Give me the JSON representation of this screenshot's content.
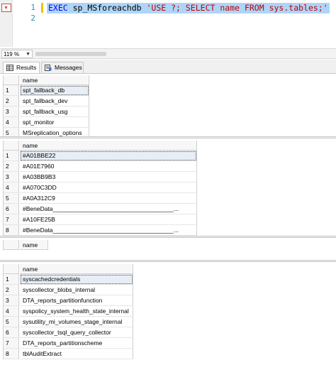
{
  "editor": {
    "line_numbers": [
      "1",
      "2"
    ],
    "code": {
      "kw1": "EXEC",
      "proc": " sp_MSforeachdb ",
      "str": "'USE ?; SELECT name FROM sys.tables;'"
    }
  },
  "zoom": {
    "value": "119 %"
  },
  "tabs": [
    {
      "label": "Results",
      "icon": "grid-icon",
      "active": true
    },
    {
      "label": "Messages",
      "icon": "messages-icon",
      "active": false
    }
  ],
  "grids": [
    {
      "column": "name",
      "rows": [
        {
          "n": "1",
          "v": "spt_fallback_db"
        },
        {
          "n": "2",
          "v": "spt_fallback_dev"
        },
        {
          "n": "3",
          "v": "spt_fallback_usg"
        },
        {
          "n": "4",
          "v": "spt_monitor"
        },
        {
          "n": "5",
          "v": "MSreplication_options"
        }
      ]
    },
    {
      "column": "name",
      "rows": [
        {
          "n": "1",
          "v": "#A01BBE22"
        },
        {
          "n": "2",
          "v": "#A01E7960"
        },
        {
          "n": "3",
          "v": "#A03BB9B3"
        },
        {
          "n": "4",
          "v": "#A070C3DD"
        },
        {
          "n": "5",
          "v": "#A0A312C9"
        },
        {
          "n": "6",
          "v": "#BeneData____________________________________..."
        },
        {
          "n": "7",
          "v": "#A10FE25B"
        },
        {
          "n": "8",
          "v": "#BeneData____________________________________..."
        }
      ]
    },
    {
      "column": "name",
      "rows": []
    },
    {
      "column": "name",
      "rows": [
        {
          "n": "1",
          "v": "syscachedcredentials"
        },
        {
          "n": "2",
          "v": "syscollector_blobs_internal"
        },
        {
          "n": "3",
          "v": "DTA_reports_partitionfunction"
        },
        {
          "n": "4",
          "v": "syspolicy_system_health_state_internal"
        },
        {
          "n": "5",
          "v": "sysutility_mi_volumes_stage_internal"
        },
        {
          "n": "6",
          "v": "syscollector_tsql_query_collector"
        },
        {
          "n": "7",
          "v": "DTA_reports_partitionscheme"
        },
        {
          "n": "8",
          "v": "tblAuditExtract"
        }
      ]
    }
  ],
  "colors": {
    "selection": "#aed5f8",
    "keyword": "#0000ff",
    "string": "#c00000",
    "line_number": "#2b91af"
  }
}
